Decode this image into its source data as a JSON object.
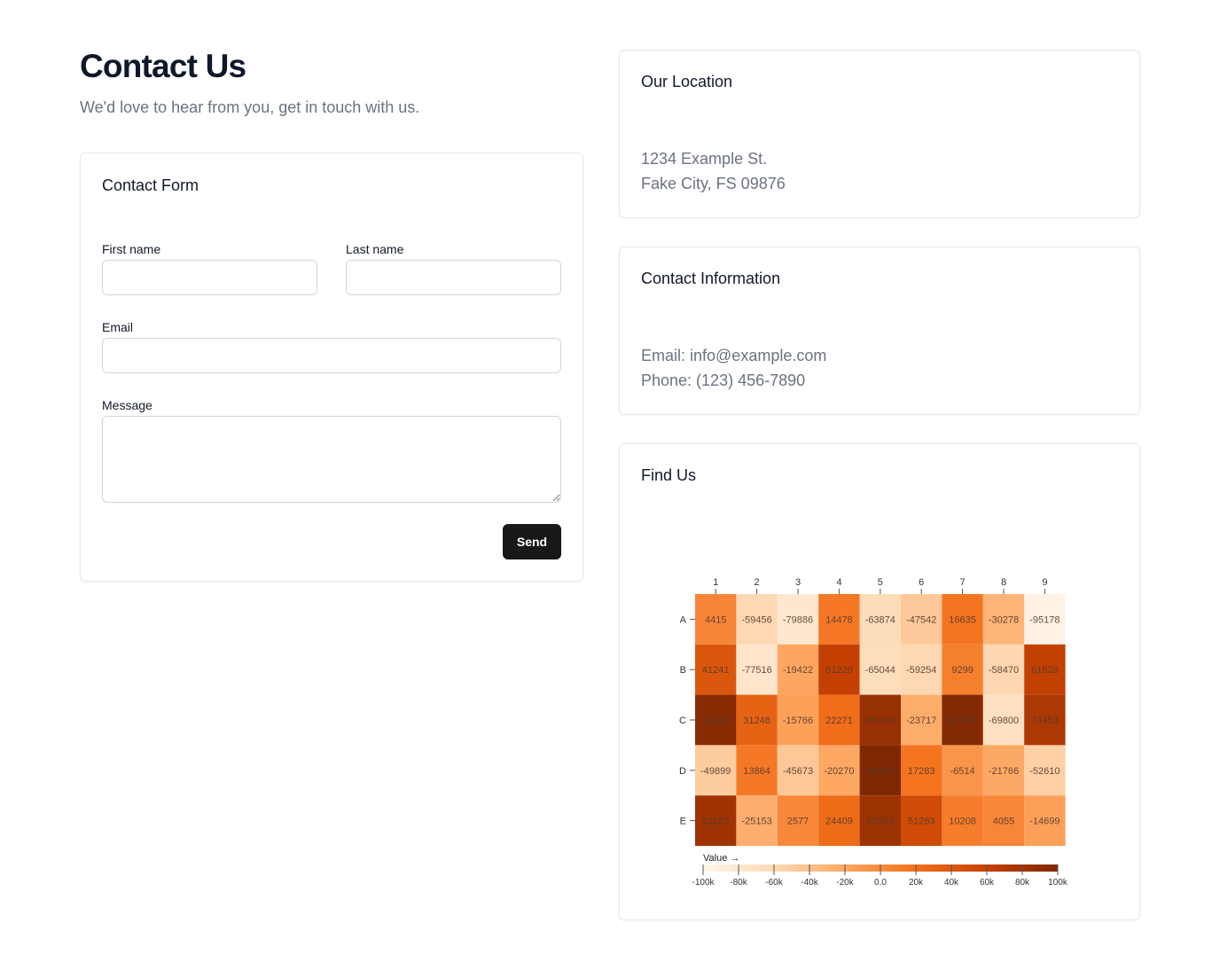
{
  "header": {
    "title": "Contact Us",
    "subtitle": "We'd love to hear from you, get in touch with us."
  },
  "form": {
    "title": "Contact Form",
    "first_name_label": "First name",
    "first_name_value": "",
    "last_name_label": "Last name",
    "last_name_value": "",
    "email_label": "Email",
    "email_value": "",
    "message_label": "Message",
    "message_value": "",
    "send_label": "Send"
  },
  "location": {
    "title": "Our Location",
    "line1": "1234 Example St.",
    "line2": "Fake City, FS 09876"
  },
  "contact_info": {
    "title": "Contact Information",
    "email": "Email: info@example.com",
    "phone": "Phone: (123) 456-7890"
  },
  "find_us": {
    "title": "Find Us"
  },
  "chart_data": {
    "type": "heatmap",
    "columns": [
      "1",
      "2",
      "3",
      "4",
      "5",
      "6",
      "7",
      "8",
      "9"
    ],
    "rows": [
      "A",
      "B",
      "C",
      "D",
      "E"
    ],
    "values": [
      [
        4415,
        -59456,
        -79886,
        14478,
        -63874,
        -47542,
        16635,
        -30278,
        -95178
      ],
      [
        41241,
        -77516,
        -19422,
        61220,
        -65044,
        -59254,
        9299,
        -58470,
        61828
      ],
      [
        94426,
        31248,
        -15766,
        22271,
        86246,
        -23717,
        97595,
        -69800,
        74453
      ],
      [
        -49899,
        13864,
        -45673,
        -20270,
        99430,
        17283,
        -6514,
        -21766,
        -52610
      ],
      [
        81123,
        -25153,
        2577,
        24409,
        82923,
        51283,
        10208,
        4055,
        -14699
      ]
    ],
    "colorbar": {
      "label": "Value →",
      "range": [
        -100000,
        100000
      ],
      "ticks": [
        "-100k",
        "-80k",
        "-60k",
        "-40k",
        "-20k",
        "0.0",
        "20k",
        "40k",
        "60k",
        "80k",
        "100k"
      ],
      "colors": [
        "#fff5eb",
        "#fdd9b4",
        "#fda762",
        "#f3701b",
        "#c54102",
        "#7f2704"
      ]
    }
  }
}
